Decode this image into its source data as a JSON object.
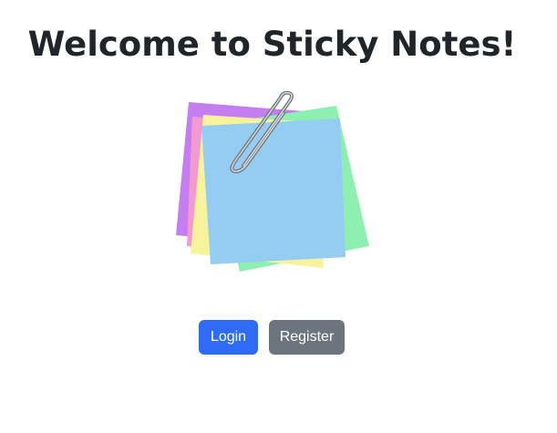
{
  "page": {
    "title": "Welcome to Sticky Notes!"
  },
  "illustration": {
    "icon": "sticky-notes-with-paperclip",
    "colors": {
      "purple": "#c57ef0",
      "pink": "#f59ad0",
      "yellow": "#f7f39a",
      "green": "#8ef0b0",
      "blue": "#94cdf1",
      "clip": "#8a8f96"
    }
  },
  "actions": {
    "login_label": "Login",
    "register_label": "Register"
  },
  "colors": {
    "primary": "#2f6bf6",
    "secondary": "#6c757d",
    "text": "#212529"
  }
}
